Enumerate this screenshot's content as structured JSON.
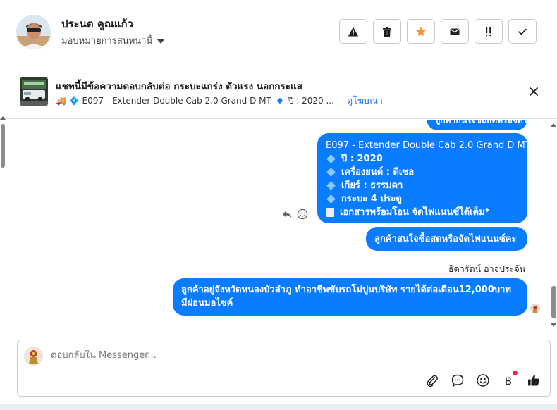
{
  "header": {
    "contact_name": "ประนต คูณแก้ว",
    "assign_label": "มอบหมายการสนทนานี้",
    "actions": [
      {
        "name": "report-button",
        "icon": "warning-icon"
      },
      {
        "name": "delete-button",
        "icon": "trash-icon"
      },
      {
        "name": "star-button",
        "icon": "star-icon"
      },
      {
        "name": "mark-unread-button",
        "icon": "envelope-icon"
      },
      {
        "name": "follow-up-button",
        "icon": "follow-up-icon"
      },
      {
        "name": "done-button",
        "icon": "check-icon"
      }
    ]
  },
  "ad": {
    "title": "แชทนี้มีข้อความตอบกลับต่อ กระบะแกร่ง ตัวแรง นอกกระแส",
    "subtitle": "🚚 💠 E097 - Extender Double Cab 2.0 Grand D MT",
    "year_label": "ปี : 2020 ...",
    "view_ad_link": "ดูโฆษณา"
  },
  "chat": {
    "top_partial_text": "ลูกค้าสนใจซื้อสดหรือจัดไฟแนนซ์คะ",
    "info_lines": [
      "E097 - Extender Double Cab 2.0 Grand D MT",
      "ปี : 2020",
      "เครื่องยนต์ : ดีเซล",
      "เกียร์ : ธรรมดา",
      "กระบะ 4 ประตู",
      "เอกสารพร้อมโอน จัดไฟแนนซ์ได้เต็ม*"
    ],
    "question": "ลูกค้าสนใจซื้อสดหรือจัดไฟแนนซ์คะ",
    "sender_name": "ธิดารัตน์ อาจประจัน",
    "answer": "ลูกค้าอยู่จังหวัดหนองบัวลำภู ทำอาชีพขับรถโม่ปูนบริษัท รายได้ต่อเดือน12,000บาท มีผ่อนมอไซค์"
  },
  "composer": {
    "placeholder": "ตอบกลับใน Messenger...",
    "tools": [
      "paperclip-icon",
      "quick-reply-icon",
      "emoji-icon",
      "baht-icon",
      "thumbs-up-icon"
    ]
  },
  "colors": {
    "bubble_blue": "#0a7cff",
    "link_blue": "#1877f2",
    "star_orange": "#f7923a"
  }
}
